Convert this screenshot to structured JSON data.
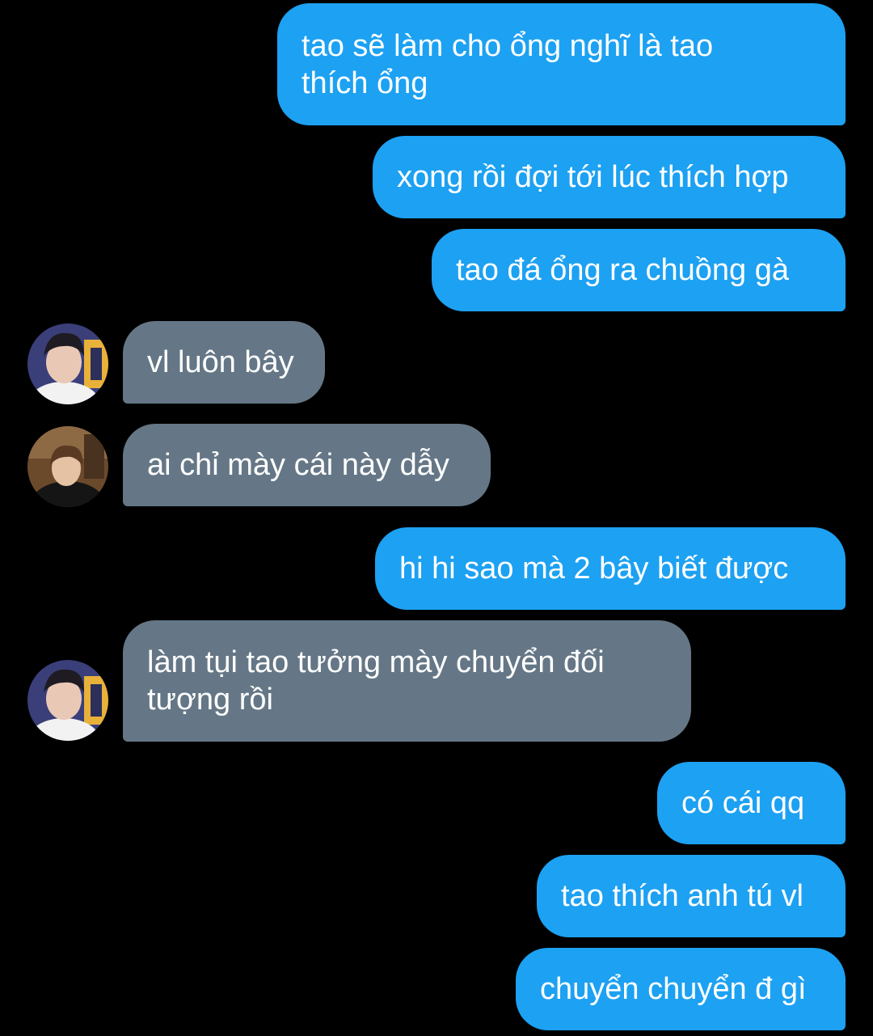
{
  "colors": {
    "background": "#000000",
    "sent_bubble": "#1da1f2",
    "received_bubble": "#657786",
    "text": "#ffffff"
  },
  "messages": [
    {
      "direction": "sent",
      "text": "tao sẽ làm cho ổng nghĩ là tao\nthích ổng"
    },
    {
      "direction": "sent",
      "text": "xong rồi đợi tới lúc thích hợp"
    },
    {
      "direction": "sent",
      "text": "tao đá ổng ra chuồng gà"
    },
    {
      "direction": "received",
      "avatar": "avatar-1",
      "text": "vl luôn bây"
    },
    {
      "direction": "received",
      "avatar": "avatar-2",
      "text": "ai chỉ mày cái này dẫy"
    },
    {
      "direction": "sent",
      "text": "hi hi sao mà 2 bây biết được"
    },
    {
      "direction": "received",
      "avatar": "avatar-1",
      "text": "làm tụi tao tưởng mày chuyển đối\ntượng rồi"
    },
    {
      "direction": "sent",
      "text": "có cái qq"
    },
    {
      "direction": "sent",
      "text": "tao thích anh tú vl"
    },
    {
      "direction": "sent",
      "text": "chuyển chuyển đ gì"
    }
  ]
}
